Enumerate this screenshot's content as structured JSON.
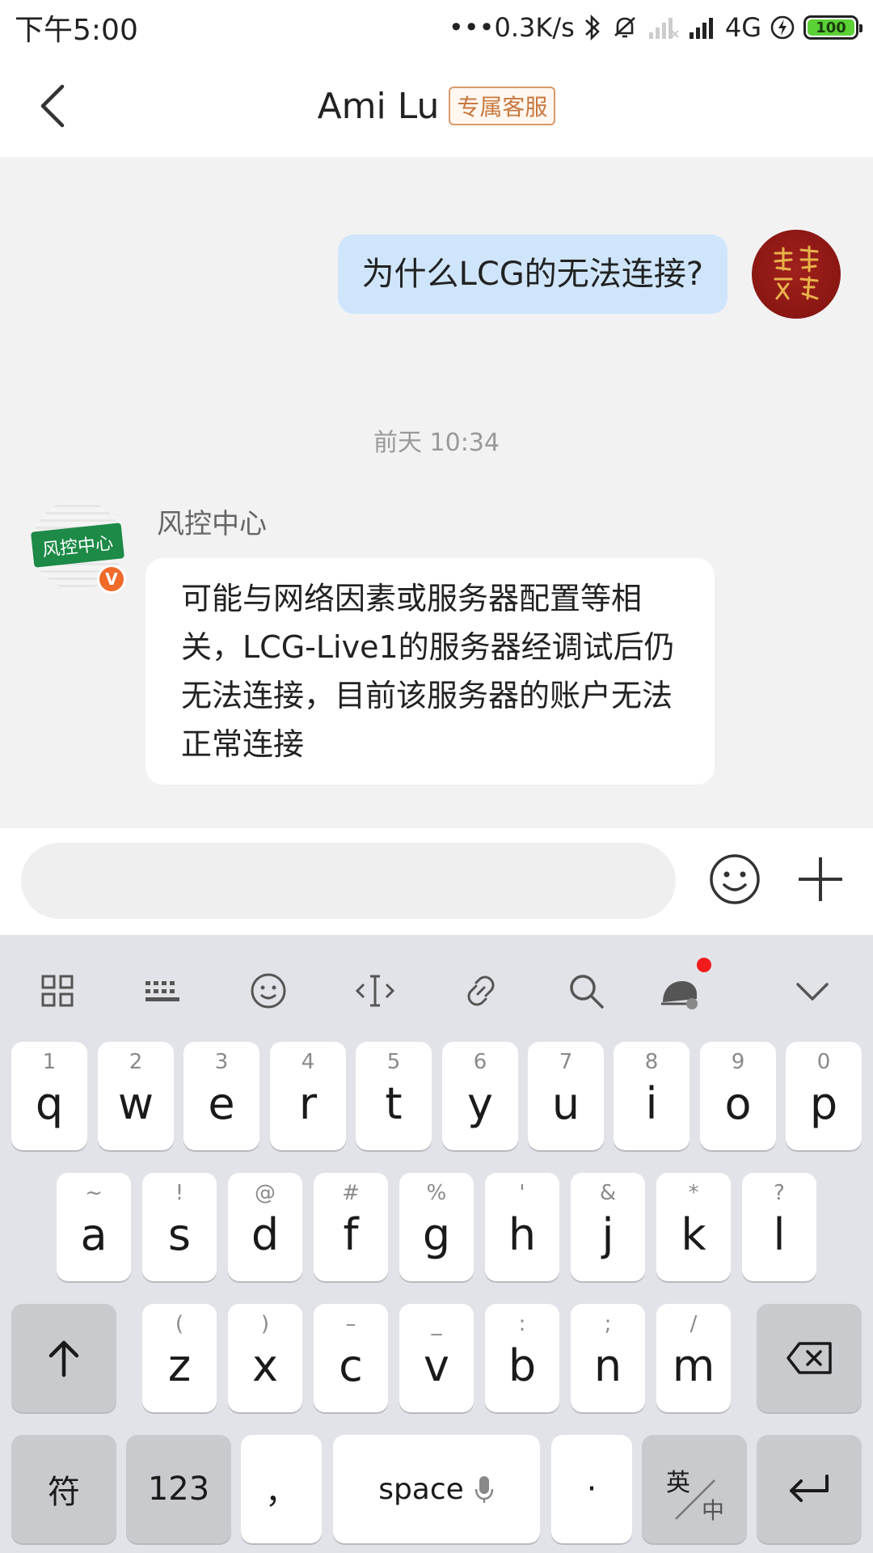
{
  "status_bar": {
    "time": "下午5:00",
    "net_speed": "•••0.3K/s",
    "network": "4G",
    "battery": "100"
  },
  "header": {
    "title": "Ami Lu",
    "badge": "专属客服"
  },
  "messages": {
    "me_text": "为什么LCG的无法连接?",
    "timestamp": "前天 10:34",
    "other_sender": "风控中心",
    "other_avatar_text": "风控中心",
    "other_badge": "V",
    "other_text": "可能与网络因素或服务器配置等相关，LCG-Live1的服务器经调试后仍无法连接，目前该服务器的账户无法正常连接"
  },
  "input": {
    "placeholder": ""
  },
  "keyboard": {
    "row1": [
      {
        "hint": "1",
        "key": "q"
      },
      {
        "hint": "2",
        "key": "w"
      },
      {
        "hint": "3",
        "key": "e"
      },
      {
        "hint": "4",
        "key": "r"
      },
      {
        "hint": "5",
        "key": "t"
      },
      {
        "hint": "6",
        "key": "y"
      },
      {
        "hint": "7",
        "key": "u"
      },
      {
        "hint": "8",
        "key": "i"
      },
      {
        "hint": "9",
        "key": "o"
      },
      {
        "hint": "0",
        "key": "p"
      }
    ],
    "row2": [
      {
        "hint": "~",
        "key": "a"
      },
      {
        "hint": "!",
        "key": "s"
      },
      {
        "hint": "@",
        "key": "d"
      },
      {
        "hint": "#",
        "key": "f"
      },
      {
        "hint": "%",
        "key": "g"
      },
      {
        "hint": "'",
        "key": "h"
      },
      {
        "hint": "&",
        "key": "j"
      },
      {
        "hint": "*",
        "key": "k"
      },
      {
        "hint": "?",
        "key": "l"
      }
    ],
    "row3": [
      {
        "hint": "(",
        "key": "z"
      },
      {
        "hint": ")",
        "key": "x"
      },
      {
        "hint": "–",
        "key": "c"
      },
      {
        "hint": "_",
        "key": "v"
      },
      {
        "hint": ":",
        "key": "b"
      },
      {
        "hint": ";",
        "key": "n"
      },
      {
        "hint": "/",
        "key": "m"
      }
    ],
    "symbols_label": "符",
    "numbers_label": "123",
    "comma_label": "，",
    "space_label": "space",
    "period_label": "·",
    "lang_en": "英",
    "lang_zh": "中"
  },
  "colors": {
    "my_bubble": "#cfe5fb",
    "accent_badge": "#c8783f",
    "brand_green": "#1d8a48",
    "verified_orange": "#f06a2a"
  }
}
